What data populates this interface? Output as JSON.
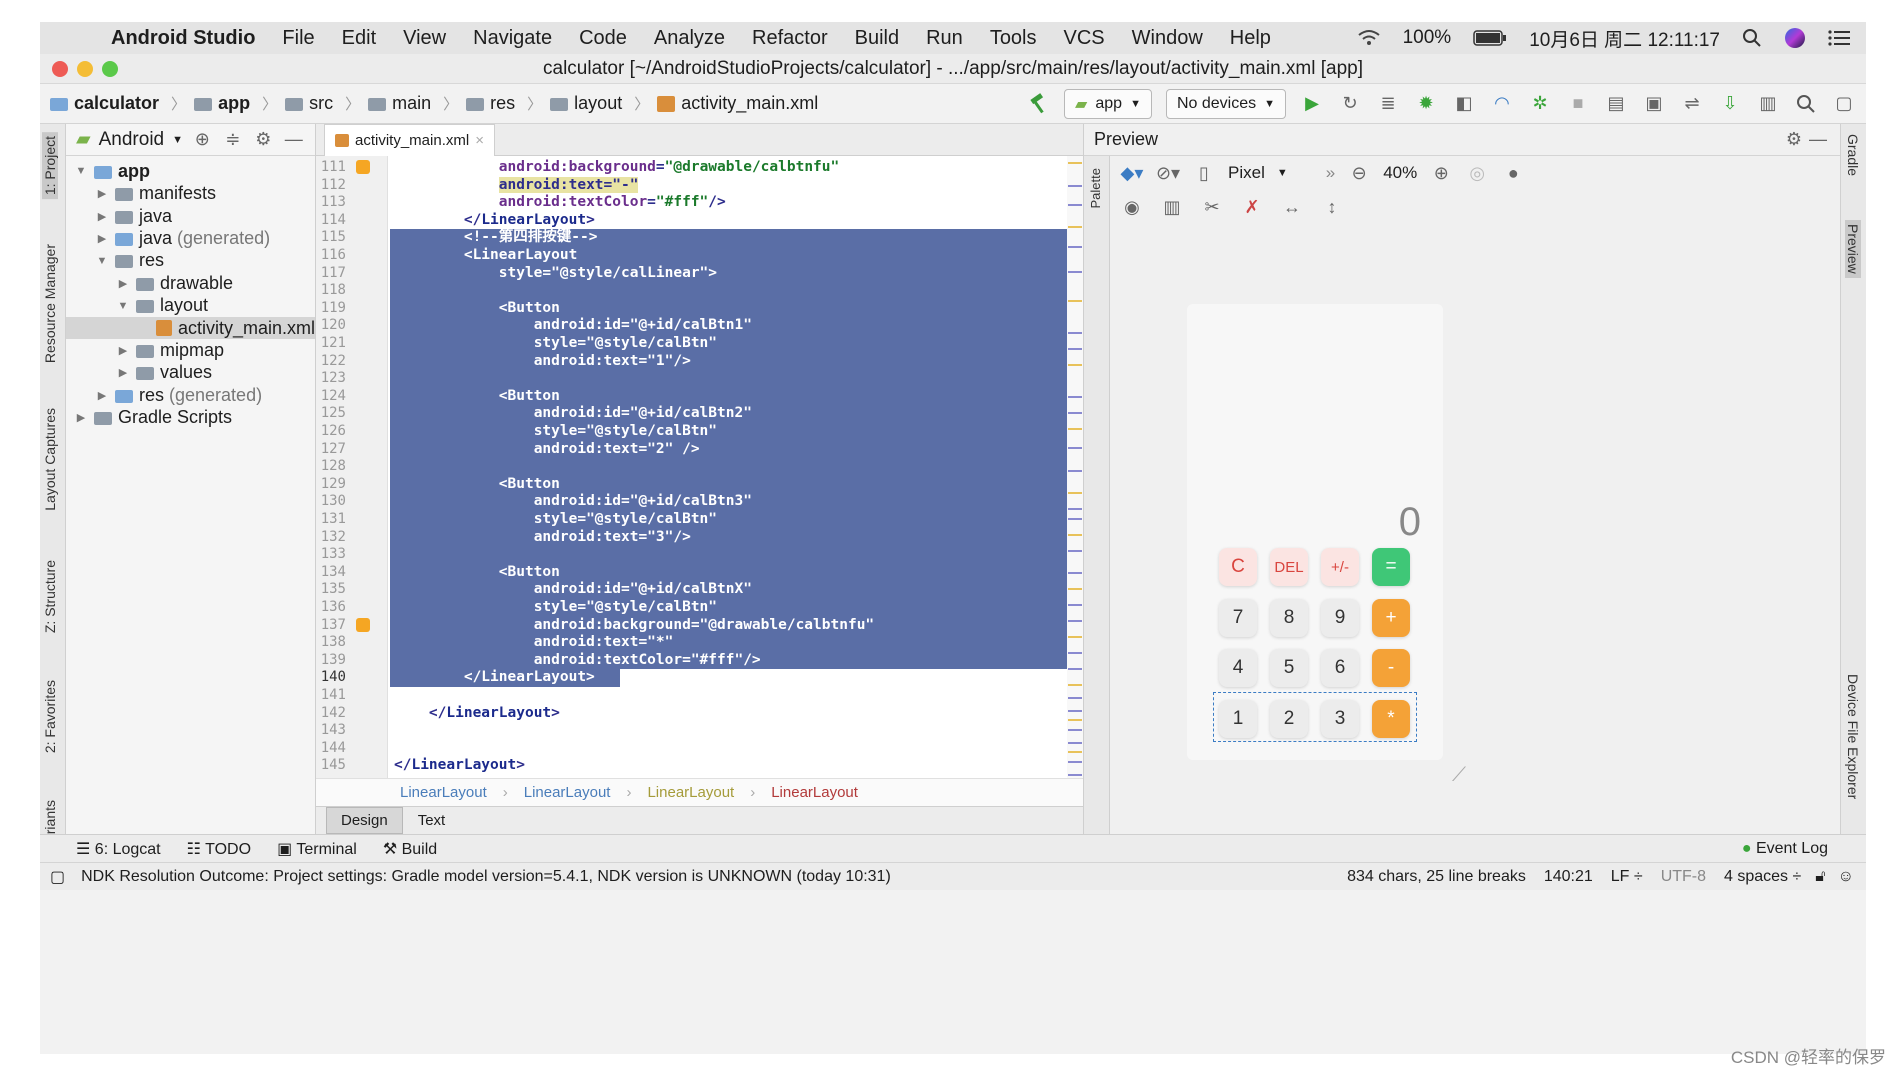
{
  "menubar": {
    "app_name": "Android Studio",
    "items": [
      "File",
      "Edit",
      "View",
      "Navigate",
      "Code",
      "Analyze",
      "Refactor",
      "Build",
      "Run",
      "Tools",
      "VCS",
      "Window",
      "Help"
    ],
    "battery": "100%",
    "datetime": "10月6日 周二  12:11:17"
  },
  "titlebar": {
    "title": "calculator [~/AndroidStudioProjects/calculator] - .../app/src/main/res/layout/activity_main.xml [app]"
  },
  "navbar": {
    "crumbs": [
      "calculator",
      "app",
      "src",
      "main",
      "res",
      "layout",
      "activity_main.xml"
    ],
    "config": "app",
    "devices": "No devices"
  },
  "left_tabs": [
    "1: Project",
    "Resource Manager",
    "Layout Captures",
    "Z: Structure",
    "2: Favorites",
    "riants"
  ],
  "project": {
    "view": "Android",
    "tree": [
      {
        "label": "app",
        "level": 0,
        "open": true
      },
      {
        "label": "manifests",
        "level": 1
      },
      {
        "label": "java",
        "level": 1
      },
      {
        "label": "java",
        "suffix": "(generated)",
        "level": 1
      },
      {
        "label": "res",
        "level": 1,
        "open": true
      },
      {
        "label": "drawable",
        "level": 2
      },
      {
        "label": "layout",
        "level": 2,
        "open": true
      },
      {
        "label": "activity_main.xml",
        "level": 3,
        "selected": true
      },
      {
        "label": "mipmap",
        "level": 2
      },
      {
        "label": "values",
        "level": 2
      },
      {
        "label": "res",
        "suffix": "(generated)",
        "level": 1
      },
      {
        "label": "Gradle Scripts",
        "level": 0
      }
    ]
  },
  "editor": {
    "tab": "activity_main.xml",
    "first_line": 111,
    "current_line": 140,
    "lines": [
      {
        "indent": "            ",
        "segs": [
          [
            "attr",
            "android:"
          ],
          [
            "attr",
            "background"
          ],
          [
            "p",
            "="
          ],
          [
            "val",
            "\"@drawable/calbtnfu\""
          ]
        ]
      },
      {
        "indent": "            ",
        "segs": [
          [
            "hl",
            "android:text=\"-\""
          ]
        ]
      },
      {
        "indent": "            ",
        "segs": [
          [
            "attr",
            "android:textColor"
          ],
          [
            "p",
            "="
          ],
          [
            "val",
            "\"#fff\""
          ],
          [
            "p",
            "/>"
          ]
        ]
      },
      {
        "indent": "        ",
        "segs": [
          [
            "p",
            "</"
          ],
          [
            "tag",
            "LinearLayout"
          ],
          [
            "p",
            ">"
          ]
        ]
      },
      {
        "indent": "        ",
        "sel": true,
        "segs": [
          [
            "p",
            "<!--第四排按键-->"
          ]
        ]
      },
      {
        "indent": "        ",
        "sel": true,
        "segs": [
          [
            "p",
            "<LinearLayout"
          ]
        ]
      },
      {
        "indent": "            ",
        "sel": true,
        "segs": [
          [
            "p",
            "style=\"@style/calLinear\">"
          ]
        ]
      },
      {
        "indent": "",
        "sel": true,
        "segs": []
      },
      {
        "indent": "            ",
        "sel": true,
        "segs": [
          [
            "p",
            "<Button"
          ]
        ]
      },
      {
        "indent": "                ",
        "sel": true,
        "segs": [
          [
            "p",
            "android:id=\"@+id/calBtn1\""
          ]
        ]
      },
      {
        "indent": "                ",
        "sel": true,
        "segs": [
          [
            "p",
            "style=\"@style/calBtn\""
          ]
        ]
      },
      {
        "indent": "                ",
        "sel": true,
        "segs": [
          [
            "p",
            "android:text=\"1\"/>"
          ]
        ]
      },
      {
        "indent": "",
        "sel": true,
        "segs": []
      },
      {
        "indent": "            ",
        "sel": true,
        "segs": [
          [
            "p",
            "<Button"
          ]
        ]
      },
      {
        "indent": "                ",
        "sel": true,
        "segs": [
          [
            "p",
            "android:id=\"@+id/calBtn2\""
          ]
        ]
      },
      {
        "indent": "                ",
        "sel": true,
        "segs": [
          [
            "p",
            "style=\"@style/calBtn\""
          ]
        ]
      },
      {
        "indent": "                ",
        "sel": true,
        "segs": [
          [
            "p",
            "android:text=\"2\" />"
          ]
        ]
      },
      {
        "indent": "",
        "sel": true,
        "segs": []
      },
      {
        "indent": "            ",
        "sel": true,
        "segs": [
          [
            "p",
            "<Button"
          ]
        ]
      },
      {
        "indent": "                ",
        "sel": true,
        "segs": [
          [
            "p",
            "android:id=\"@+id/calBtn3\""
          ]
        ]
      },
      {
        "indent": "                ",
        "sel": true,
        "segs": [
          [
            "p",
            "style=\"@style/calBtn\""
          ]
        ]
      },
      {
        "indent": "                ",
        "sel": true,
        "segs": [
          [
            "p",
            "android:text=\"3\"/>"
          ]
        ]
      },
      {
        "indent": "",
        "sel": true,
        "segs": []
      },
      {
        "indent": "            ",
        "sel": true,
        "segs": [
          [
            "p",
            "<Button"
          ]
        ]
      },
      {
        "indent": "                ",
        "sel": true,
        "segs": [
          [
            "p",
            "android:id=\"@+id/calBtnX\""
          ]
        ]
      },
      {
        "indent": "                ",
        "sel": true,
        "segs": [
          [
            "p",
            "style=\"@style/calBtn\""
          ]
        ]
      },
      {
        "indent": "                ",
        "sel": true,
        "segs": [
          [
            "p",
            "android:background=\"@drawable/calbtnfu\""
          ]
        ]
      },
      {
        "indent": "                ",
        "sel": true,
        "segs": [
          [
            "p",
            "android:text=\"*\""
          ]
        ]
      },
      {
        "indent": "                ",
        "sel": true,
        "segs": [
          [
            "p",
            "android:textColor=\"#fff\"/>"
          ]
        ]
      },
      {
        "indent": "        ",
        "sel": true,
        "partial": true,
        "segs": [
          [
            "p",
            "</LinearLayout>"
          ]
        ]
      },
      {
        "indent": "",
        "segs": []
      },
      {
        "indent": "    ",
        "segs": [
          [
            "p",
            "</"
          ],
          [
            "tag",
            "LinearLayout"
          ],
          [
            "p",
            ">"
          ]
        ]
      },
      {
        "indent": "",
        "segs": []
      },
      {
        "indent": "",
        "segs": []
      },
      {
        "indent": "",
        "segs": [
          [
            "p",
            "</"
          ],
          [
            "tag",
            "LinearLayout"
          ],
          [
            "p",
            ">"
          ]
        ]
      }
    ],
    "breadcrumb": [
      "LinearLayout",
      "LinearLayout",
      "LinearLayout",
      "LinearLayout"
    ],
    "design_tab": "Design",
    "text_tab": "Text"
  },
  "preview": {
    "title": "Preview",
    "palette_label": "Palette",
    "device": "Pixel",
    "zoom": "40%",
    "display": "0",
    "buttons": [
      [
        {
          "t": "C",
          "k": "f"
        },
        {
          "t": "DEL",
          "k": "f"
        },
        {
          "t": "+/-",
          "k": "f"
        },
        {
          "t": "=",
          "k": "g"
        }
      ],
      [
        {
          "t": "7",
          "k": "n"
        },
        {
          "t": "8",
          "k": "n"
        },
        {
          "t": "9",
          "k": "n"
        },
        {
          "t": "+",
          "k": "o"
        }
      ],
      [
        {
          "t": "4",
          "k": "n"
        },
        {
          "t": "5",
          "k": "n"
        },
        {
          "t": "6",
          "k": "n"
        },
        {
          "t": "-",
          "k": "o"
        }
      ],
      [
        {
          "t": "1",
          "k": "n"
        },
        {
          "t": "2",
          "k": "n"
        },
        {
          "t": "3",
          "k": "n"
        },
        {
          "t": "*",
          "k": "o"
        }
      ]
    ]
  },
  "right_tabs": [
    "Gradle",
    "Preview",
    "Device File Explorer"
  ],
  "bottom_tabs": [
    "6: Logcat",
    "TODO",
    "Terminal",
    "Build"
  ],
  "event_log": "Event Log",
  "status": {
    "message": "NDK Resolution Outcome: Project settings: Gradle model version=5.4.1, NDK version is UNKNOWN (today 10:31)",
    "chars": "834 chars, 25 line breaks",
    "position": "140:21",
    "line_sep": "LF ÷",
    "encoding": "UTF-8",
    "indent": "4 spaces ÷"
  },
  "watermark": "CSDN @轻率的保罗",
  "colors": {
    "selection": "#5a6ea6",
    "accent_orange": "#f4a237",
    "accent_green": "#3fc777"
  }
}
